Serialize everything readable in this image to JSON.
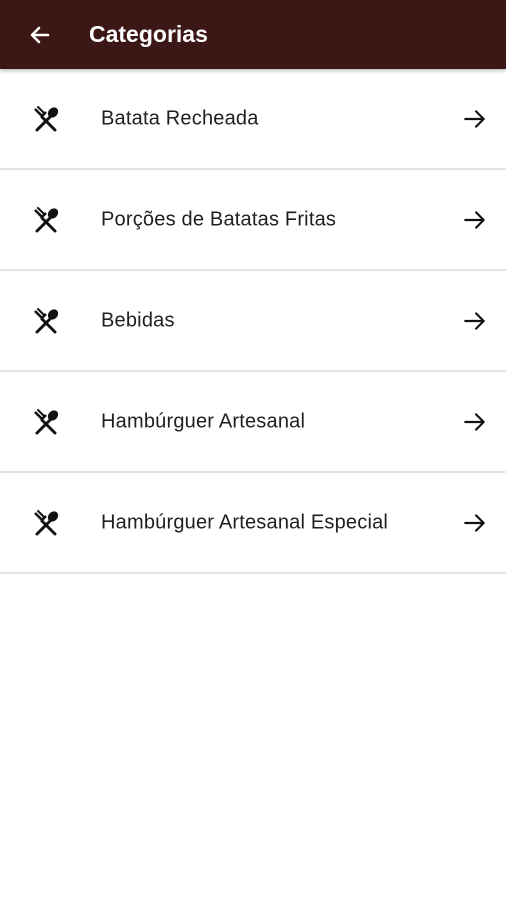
{
  "app_bar": {
    "title": "Categorias",
    "back_icon": "arrow-left-icon",
    "background_color": "#3b1815"
  },
  "categories": [
    {
      "label": "Batata Recheada",
      "icon": "utensils-icon",
      "action_icon": "arrow-right-icon"
    },
    {
      "label": "Porções de Batatas Fritas",
      "icon": "utensils-icon",
      "action_icon": "arrow-right-icon"
    },
    {
      "label": "Bebidas",
      "icon": "utensils-icon",
      "action_icon": "arrow-right-icon"
    },
    {
      "label": "Hambúrguer Artesanal",
      "icon": "utensils-icon",
      "action_icon": "arrow-right-icon"
    },
    {
      "label": "Hambúrguer Artesanal Especial",
      "icon": "utensils-icon",
      "action_icon": "arrow-right-icon"
    }
  ]
}
